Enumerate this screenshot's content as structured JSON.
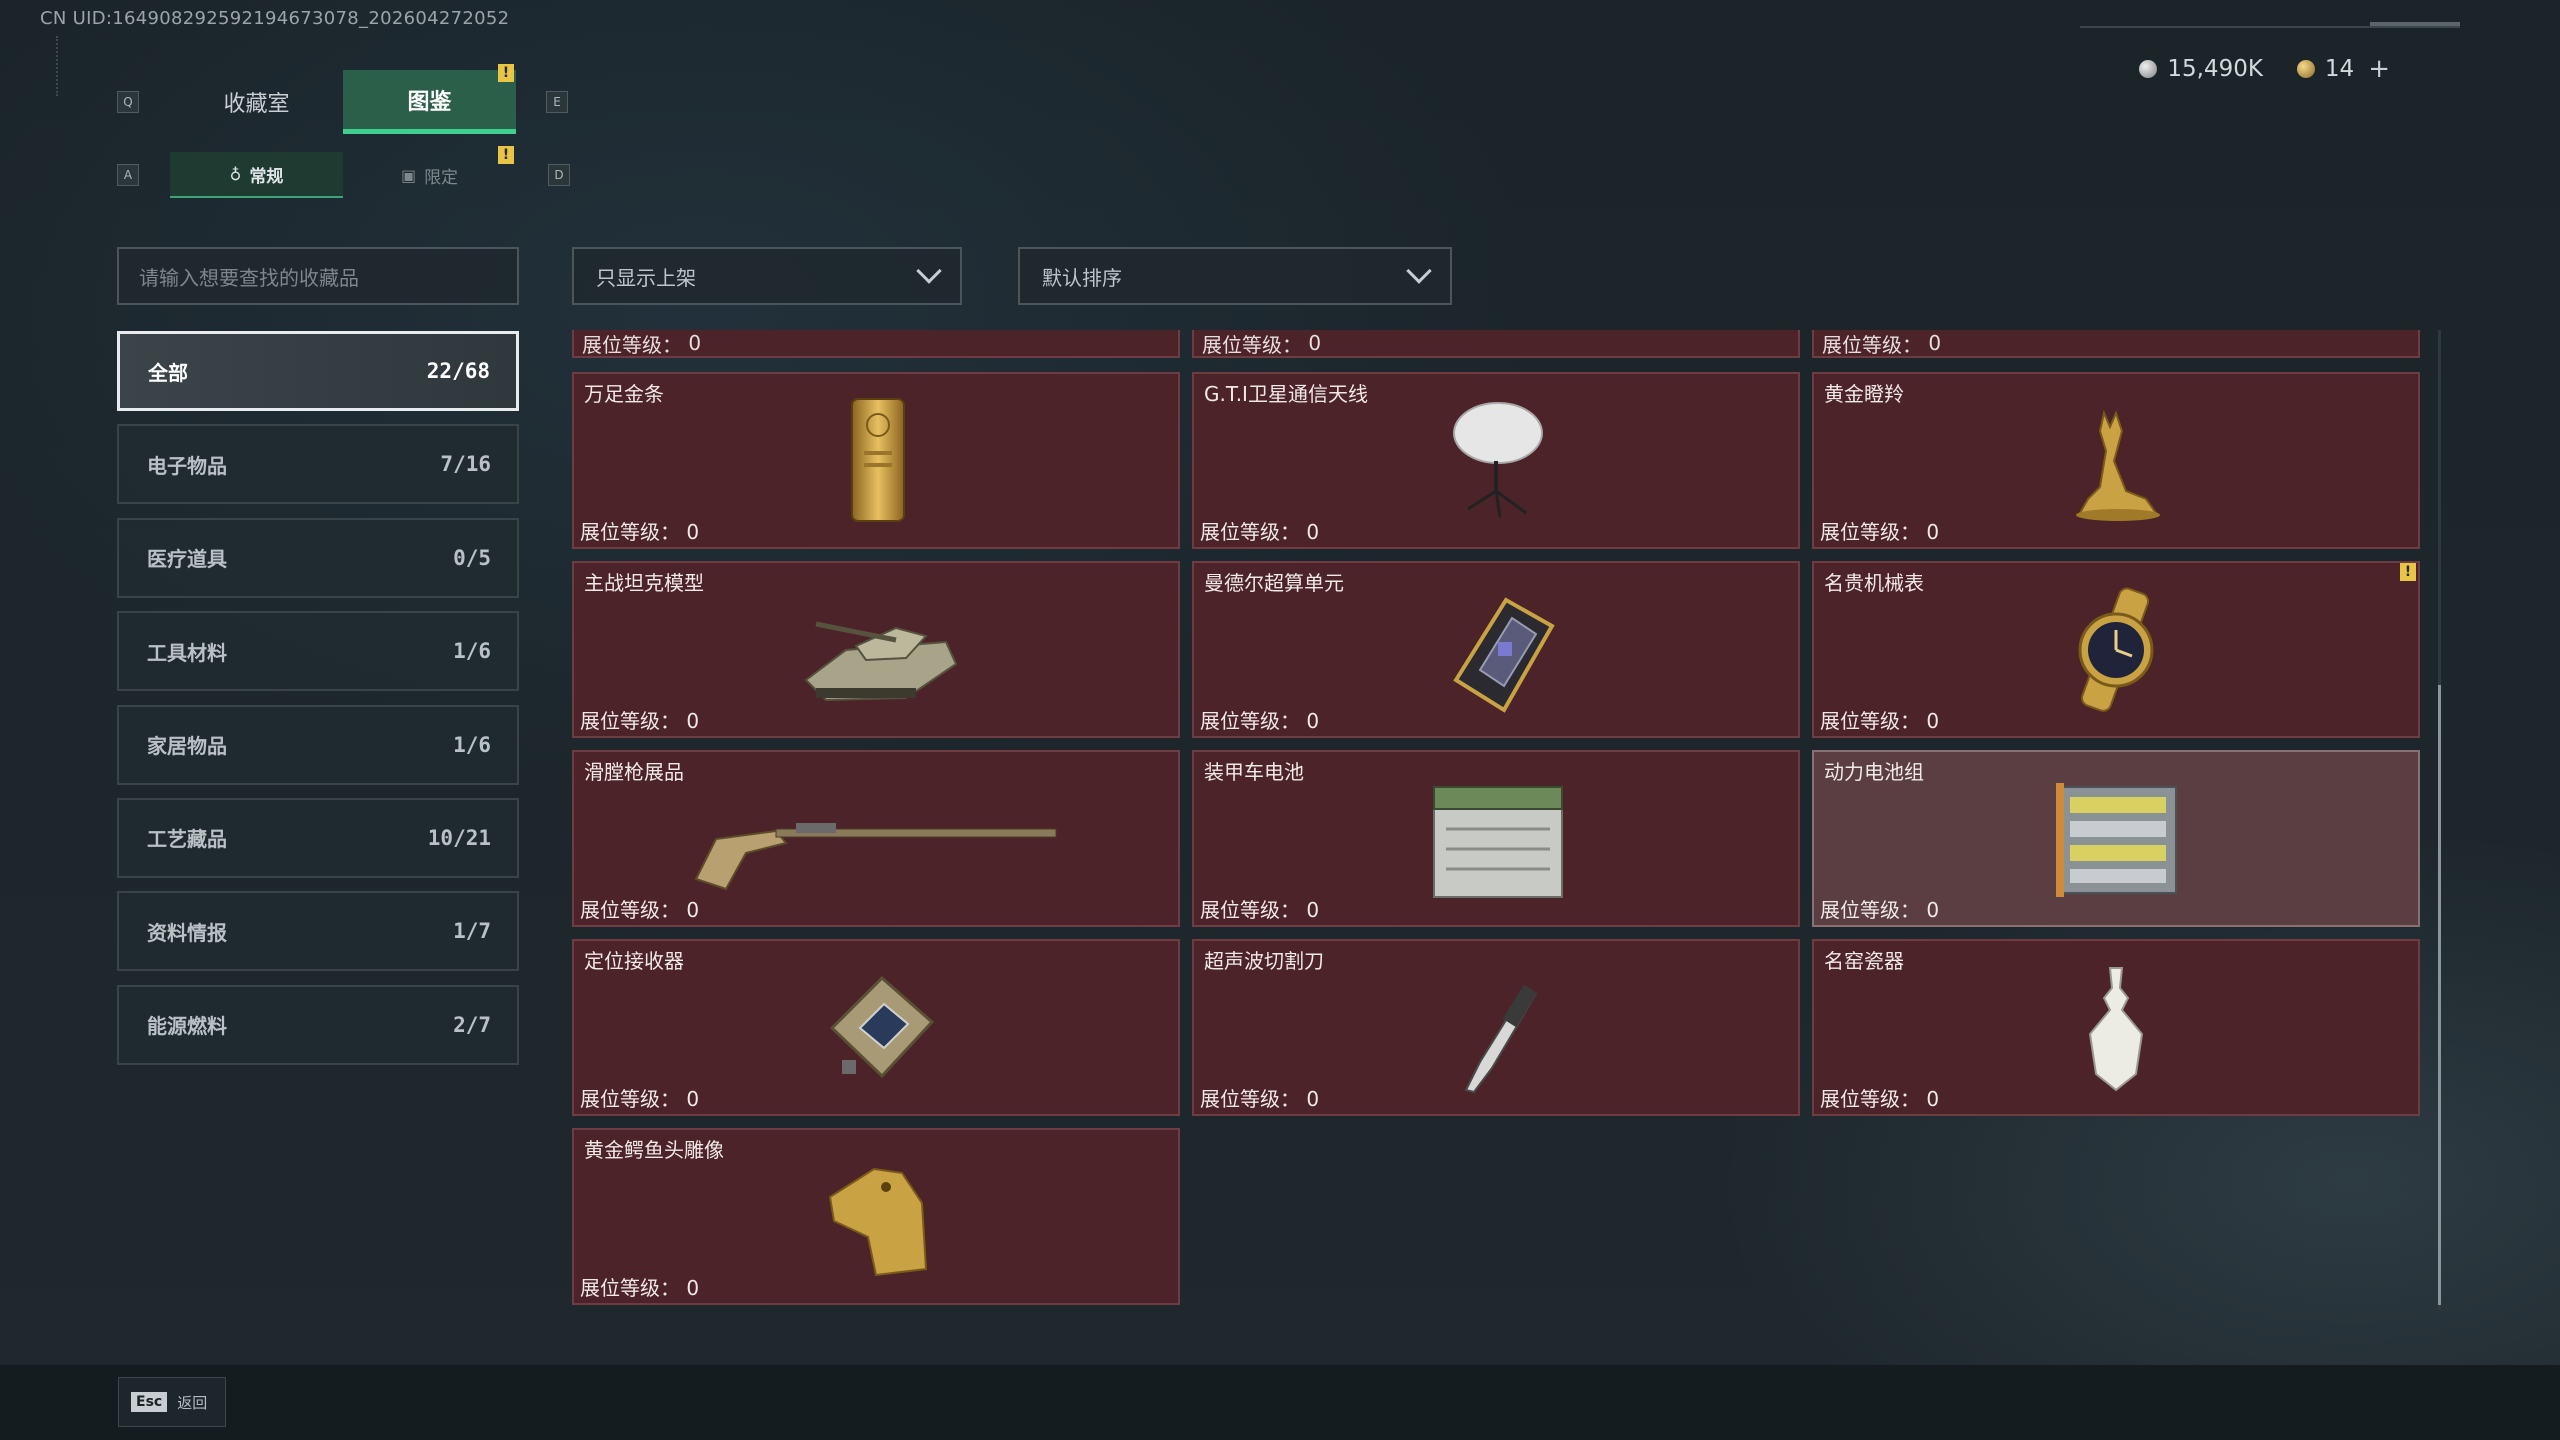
{
  "uid": "CN UID:164908292592194673078_202604272052",
  "keys": {
    "prev_tab": "Q",
    "next_tab": "E",
    "prev_sub": "A",
    "next_sub": "D"
  },
  "tabs": [
    {
      "label": "收藏室",
      "active": false
    },
    {
      "label": "图鉴",
      "active": true
    }
  ],
  "subtabs": [
    {
      "label": "常规",
      "active": true
    },
    {
      "label": "限定",
      "active": false
    }
  ],
  "alert_mark": "!",
  "currency": {
    "silver": "15,490K",
    "gold": "14",
    "add": "+"
  },
  "search": {
    "placeholder": "请输入想要查找的收藏品"
  },
  "filters": {
    "shelf": "只显示上架",
    "sort": "默认排序"
  },
  "categories": [
    {
      "label": "全部",
      "count": "22/68",
      "active": true
    },
    {
      "label": "电子物品",
      "count": "7/16"
    },
    {
      "label": "医疗道具",
      "count": "0/5"
    },
    {
      "label": "工具材料",
      "count": "1/6"
    },
    {
      "label": "家居物品",
      "count": "1/6"
    },
    {
      "label": "工艺藏品",
      "count": "10/21"
    },
    {
      "label": "资料情报",
      "count": "1/7"
    },
    {
      "label": "能源燃料",
      "count": "2/7"
    }
  ],
  "level_label": "展位等级：",
  "partial_row": [
    {
      "level": "0"
    },
    {
      "level": "0"
    },
    {
      "level": "0"
    }
  ],
  "items": [
    {
      "name": "万足金条",
      "level": "0",
      "icon": "gold-bar-icon"
    },
    {
      "name": "G.T.I卫星通信天线",
      "level": "0",
      "icon": "satellite-dish-icon"
    },
    {
      "name": "黄金瞪羚",
      "level": "0",
      "icon": "golden-gazelle-icon"
    },
    {
      "name": "主战坦克模型",
      "level": "0",
      "icon": "tank-model-icon"
    },
    {
      "name": "曼德尔超算单元",
      "level": "0",
      "icon": "supercomputer-unit-icon"
    },
    {
      "name": "名贵机械表",
      "level": "0",
      "icon": "watch-icon",
      "badge": true
    },
    {
      "name": "滑膛枪展品",
      "level": "0",
      "icon": "musket-icon"
    },
    {
      "name": "装甲车电池",
      "level": "0",
      "icon": "vehicle-battery-icon"
    },
    {
      "name": "动力电池组",
      "level": "0",
      "icon": "battery-pack-icon",
      "dim": true
    },
    {
      "name": "定位接收器",
      "level": "0",
      "icon": "gps-receiver-icon"
    },
    {
      "name": "超声波切割刀",
      "level": "0",
      "icon": "ultrasonic-cutter-icon"
    },
    {
      "name": "名窑瓷器",
      "level": "0",
      "icon": "porcelain-vase-icon"
    },
    {
      "name": "黄金鳄鱼头雕像",
      "level": "0",
      "icon": "gold-crocodile-head-icon"
    }
  ],
  "footer": {
    "esc": "Esc",
    "back": "返回"
  },
  "colors": {
    "accent": "#3fcf8e",
    "card_bg": "#4b2328",
    "card_border": "#6e3c42",
    "alert": "#e8c547"
  }
}
